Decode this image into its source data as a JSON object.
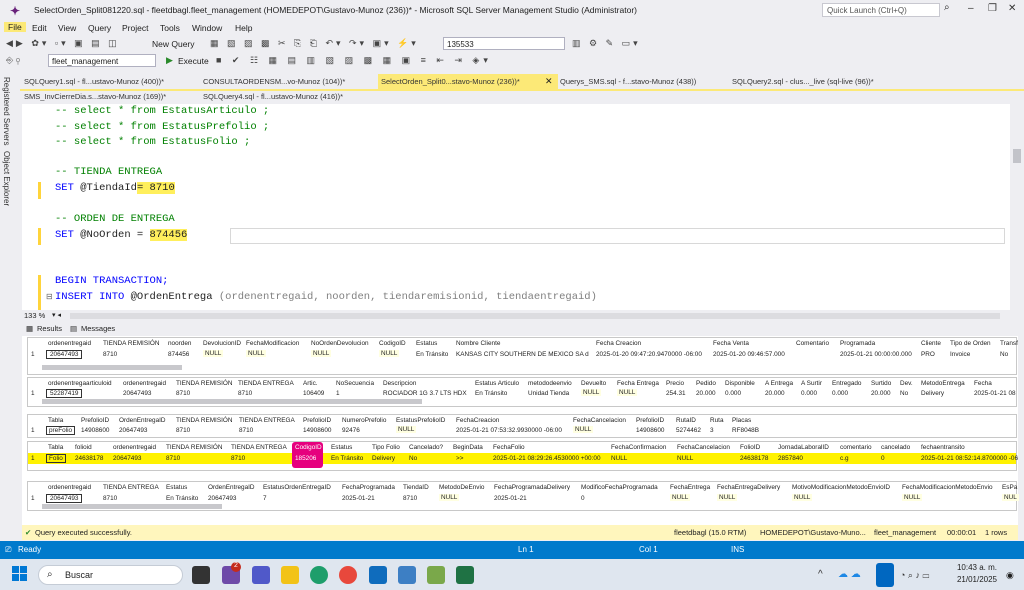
{
  "window": {
    "title": "SelectOrden_Split081220.sql - fleetdbagl.fleet_management (HOMEDEPOT\\Gustavo-Munoz (236))* - Microsoft SQL Server Management Studio (Administrator)",
    "quick_launch": "Quick Launch (Ctrl+Q)"
  },
  "menu": [
    "File",
    "Edit",
    "View",
    "Query",
    "Project",
    "Tools",
    "Window",
    "Help"
  ],
  "toolbar": {
    "new_query": "New Query",
    "combo_value": "135533",
    "database": "fleet_management",
    "execute": "Execute"
  },
  "side": {
    "registered": "Registered Servers",
    "object_explorer": "Object Explorer"
  },
  "tabs_row1": [
    "SQLQuery1.sql - fl...ustavo-Munoz (400))*",
    "CONSULTAORDENSM...vo-Munoz (104))*",
    "SelectOrden_Split0...stavo-Munoz (236))*",
    "Querys_SMS.sql - f...stavo-Munoz (438))",
    "SQLQuery2.sql - clus..._live (sql-live (96))*"
  ],
  "tabs_row2": [
    "SMS_InvCierreDia.s...stavo-Munoz (169))*",
    "SQLQuery4.sql - fl...ustavo-Munoz (416))*"
  ],
  "code": {
    "l1": "-- select * from EstatusArticulo ;",
    "l2": "-- select * from EstatusPrefolio ;",
    "l3": "-- select * from EstatusFolio ;",
    "l4": "-- TIENDA ENTREGA",
    "l5a": "SET ",
    "l5b": "@TiendaId",
    "l5c": "= ",
    "l5d": "8710",
    "l6": "-- ORDEN DE ENTREGA",
    "l7a": "SET ",
    "l7b": "@NoOrden = ",
    "l7d": "874456",
    "l8": "BEGIN TRANSACTION;",
    "l9a": "INSERT INTO ",
    "l9b": "@OrdenEntrega ",
    "l9c": "(ordenentregaid, noorden, tiendaremisionid, tiendaentregaid)"
  },
  "zoom": "133 %",
  "result_tabs": {
    "results": "Results",
    "messages": "Messages"
  },
  "grid1": {
    "headers": [
      "ordenentregaid",
      "TIENDA REMISIÓN",
      "noorden",
      "DevolucionID",
      "FechaModificacion",
      "NoOrdenDevolucion",
      "CodigoID",
      "Estatus",
      "Nombre Cliente",
      "Fecha Creacion",
      "Fecha Venta",
      "Comentario",
      "Programada",
      "Cliente",
      "Tipo de Orden",
      "Transf"
    ],
    "row": [
      "1",
      "20647493",
      "8710",
      "874456",
      "NULL",
      "NULL",
      "NULL",
      "NULL",
      "En Tránsito",
      "KANSAS CITY SOUTHERN DE MEXICO SA d",
      "2025-01-20 09:47:20.9470000 -06:00",
      "2025-01-20 09:46:57.000",
      "",
      "2025-01-21 00:00:00.000",
      "PRO",
      "Invoice",
      "No"
    ]
  },
  "grid2": {
    "headers": [
      "ordenentregaarticuloid",
      "ordenentregaid",
      "TIENDA REMISIÓN",
      "TIENDA ENTREGA",
      "Artic.",
      "NoSecuencia",
      "Descripcion",
      "Estatus Articulo",
      "metododeenvio",
      "Devuelto",
      "Fecha Entrega",
      "Precio",
      "Pedido",
      "Disponible",
      "A Entrega",
      "A Surtir",
      "Entregado",
      "Surtido",
      "Dev.",
      "MetodoEntrega",
      "Fecha"
    ],
    "row": [
      "1",
      "52287419",
      "20647493",
      "8710",
      "8710",
      "106409",
      "1",
      "ROCIADOR 1G 3.7 LTS HDX",
      "En Tránsito",
      "Unidad Tienda",
      "NULL",
      "NULL",
      "254.31",
      "20.000",
      "0.000",
      "20.000",
      "0.000",
      "0.000",
      "20.000",
      "No",
      "Delivery",
      "2025-01-21 08"
    ]
  },
  "grid3": {
    "headers": [
      "Tabla",
      "PrefolioID",
      "OrdenEntregaID",
      "TIENDA REMISIÓN",
      "TIENDA ENTREGA",
      "PrefolioID",
      "NumeroPrefolio",
      "EstatusPrefolioID",
      "FechaCreacion",
      "FechaCancelacion",
      "PrefolioID",
      "RutaID",
      "Ruta",
      "Placas"
    ],
    "row": [
      "1",
      "preFolio",
      "14908600",
      "20647493",
      "8710",
      "8710",
      "14908600",
      "92476",
      "NULL",
      "2025-01-21 07:53:32.9930000 -06:00",
      "NULL",
      "14908600",
      "5274462",
      "3",
      "RF8048B"
    ]
  },
  "grid4": {
    "headers": [
      "Tabla",
      "folioid",
      "ordenentregaid",
      "TIENDA REMISIÓN",
      "TIENDA ENTREGA",
      "CodigoID",
      "Estatus",
      "Tipo Folio",
      "Cancelado?",
      "BeginData",
      "FechaFolio",
      "FechaConfirmacion",
      "FechaCancelacion",
      "FolioID",
      "JornadaLaboralID",
      "comentario",
      "cancelado",
      "fechaentransito"
    ],
    "row": [
      "1",
      "Folio",
      "24638178",
      "20647493",
      "8710",
      "8710",
      "185206",
      "En Tránsito",
      "Delivery",
      "No",
      ">>",
      "2025-01-21 08:29:26.4530000 +00:00",
      "NULL",
      "NULL",
      "24638178",
      "2857840",
      "c.g",
      "0",
      "2025-01-21 08:52:14.8700000 -06"
    ]
  },
  "grid5": {
    "headers": [
      "ordenentregaid",
      "TIENDA ENTREGA",
      "Estatus",
      "OrdenEntregaID",
      "EstatusOrdenEntregaID",
      "FechaProgramada",
      "TiendaID",
      "MetodoDeEnvio",
      "FechaProgramadaDelivery",
      "ModificoFechaProgramada",
      "FechaEntrega",
      "FechaEntregaDelivery",
      "MotivoModificacionMetodoEnvioID",
      "FechaModificacionMetodoEnvio",
      "EsPa"
    ],
    "row": [
      "1",
      "20647493",
      "8710",
      "En Tránsito",
      "20647493",
      "7",
      "2025-01-21",
      "8710",
      "NULL",
      "2025-01-21",
      "0",
      "NULL",
      "NULL",
      "NULL",
      "NULL",
      "NUL"
    ]
  },
  "query_status": {
    "message": "Query executed successfully.",
    "server": "fleetdbagl (15.0 RTM)",
    "user": "HOMEDEPOT\\Gustavo-Muno...",
    "db": "fleet_management",
    "time": "00:00:01",
    "rows": "1 rows"
  },
  "statusbar": {
    "ready": "Ready",
    "ln": "Ln 1",
    "col": "Col 1",
    "ins": "INS"
  },
  "taskbar": {
    "search": "Buscar",
    "time": "10:43 a. m.",
    "date": "21/01/2025",
    "badge": "2"
  }
}
